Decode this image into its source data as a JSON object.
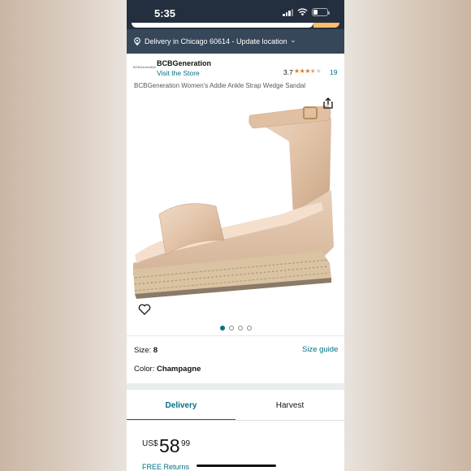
{
  "status_bar": {
    "time": "5:35",
    "battery_level": 0.3
  },
  "location_bar": {
    "pin_icon": "location-pin-icon",
    "text": "Delivery in Chicago 60614 - Update location",
    "chevron": "⌄"
  },
  "brand": {
    "logo_text": "BCBGeneration",
    "name": "BCBGeneration",
    "visit_store": "Visit the Store",
    "rating": "3.7",
    "stars_filled": 3.5,
    "star_glyphs": "★★★★★",
    "review_count": "19"
  },
  "product": {
    "title": "BCBGeneration Women's Addie Ankle Strap Wedge Sandal",
    "share_icon": "share-icon",
    "wishlist_icon": "heart-icon",
    "image_count": 4,
    "active_image": 0
  },
  "options": {
    "size_label": "Size: ",
    "size_value": "8",
    "size_guide": "Size guide",
    "color_label": "Color: ",
    "color_value": "Champagne"
  },
  "tabs": [
    {
      "label": "Delivery",
      "active": true
    },
    {
      "label": "Harvest",
      "active": false
    }
  ],
  "price": {
    "currency": "US$",
    "whole": "58",
    "fraction": "99",
    "free_returns": "FREE Returns"
  },
  "colors": {
    "header_bg": "#232f3e",
    "location_bg": "#37475a",
    "link": "#007185",
    "star": "#de7921"
  }
}
